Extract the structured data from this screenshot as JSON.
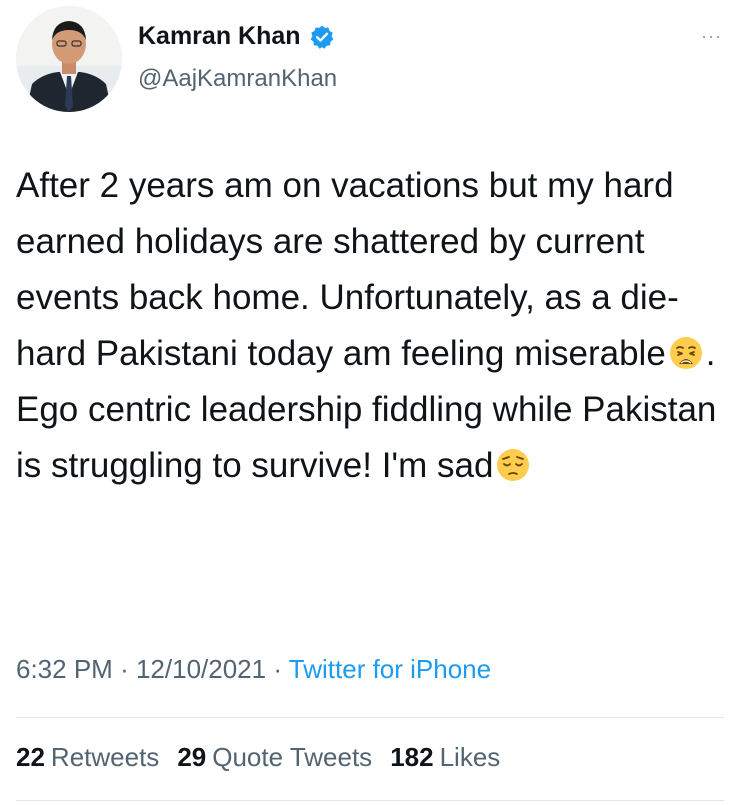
{
  "author": {
    "display_name": "Kamran Khan",
    "handle": "@AajKamranKhan",
    "verified_icon": "verified-badge-icon",
    "avatar_icon": "avatar"
  },
  "more_menu": {
    "label": "···",
    "icon": "more-icon"
  },
  "tweet": {
    "text_part1": "After 2 years am on vacations  but my hard earned holidays  are shattered by current  events back home. Unfortunately, as a die-hard Pakistani today am feeling miserable",
    "emoji1": "weary-face-emoji",
    "text_part2": ". Ego centric leadership fiddling while Pakistan is struggling to survive! I'm sad",
    "emoji2": "pensive-face-emoji"
  },
  "meta": {
    "time": "6:32 PM",
    "separator": "·",
    "date": "12/10/2021",
    "source": "Twitter for iPhone"
  },
  "stats": {
    "retweets_count": "22",
    "retweets_label": "Retweets",
    "quotes_count": "29",
    "quotes_label": "Quote Tweets",
    "likes_count": "182",
    "likes_label": "Likes"
  },
  "colors": {
    "text": "#0f1419",
    "secondary": "#536471",
    "accent": "#1d9bf0",
    "divider": "#e1e6ea"
  }
}
